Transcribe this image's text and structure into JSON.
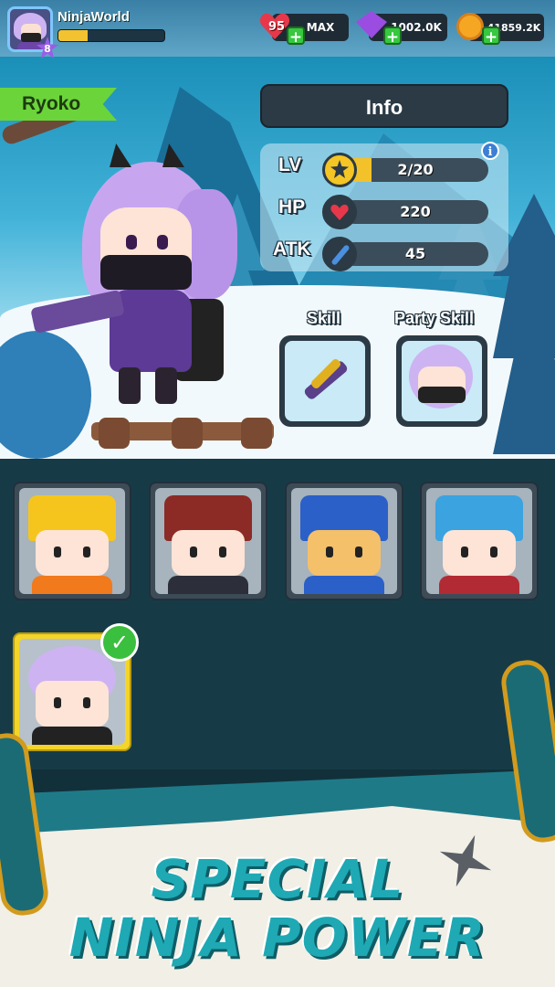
{
  "player": {
    "name": "NinjaWorld",
    "level": "8",
    "xp_fraction": 0.28
  },
  "resources": {
    "energy": "95",
    "energy_status": "MAX",
    "gems": "1002.0K",
    "coins": "41859.2K"
  },
  "character": {
    "name": "Ryoko"
  },
  "info": {
    "title": "Info",
    "info_icon": "i",
    "stats": [
      {
        "label": "LV",
        "value": "2/20",
        "fill": 0.2,
        "icon": "star-icon"
      },
      {
        "label": "HP",
        "value": "220",
        "fill": 0,
        "icon": "heart-icon"
      },
      {
        "label": "ATK",
        "value": "45",
        "fill": 0,
        "icon": "sword-icon"
      }
    ]
  },
  "skills": {
    "skill_label": "Skill",
    "party_skill_label": "Party Skill"
  },
  "roster": [
    {
      "name": "yellow-fox-ninja",
      "hair": "#f5c51d",
      "body": "#f07a1c"
    },
    {
      "name": "red-bow-ninja",
      "hair": "#8c2a26",
      "body": "#2c2f3a"
    },
    {
      "name": "shiba-ninja",
      "hair": "#2a60c8",
      "body": "#2a60c8"
    },
    {
      "name": "fox-mask-ninja",
      "hair": "#3aa3e0",
      "body": "#b22a33"
    }
  ],
  "selected": {
    "name": "ryoko",
    "check": "✓"
  },
  "banner": {
    "line1": "SPECIAL",
    "line2": "NINJA POWER"
  },
  "colors": {
    "accent_green": "#6bd43a",
    "gold": "#f3c12a",
    "teal": "#1ea9b4"
  }
}
